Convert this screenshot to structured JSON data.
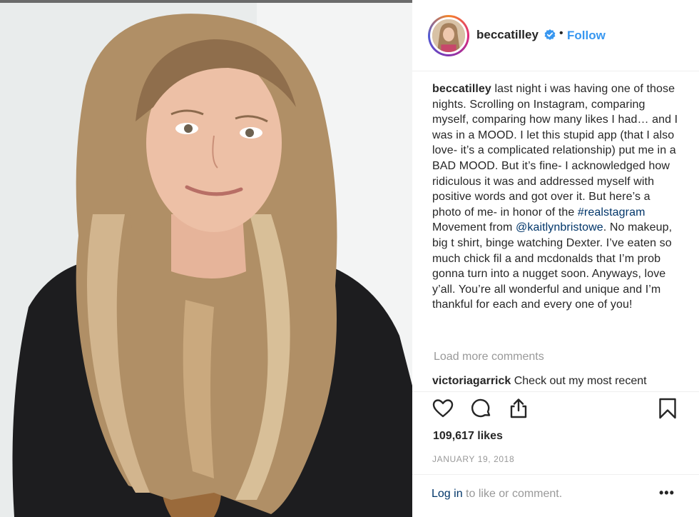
{
  "post": {
    "photo_alt": "selfie photo",
    "username": "beccatilley",
    "follow_label": "Follow",
    "separator": "•"
  },
  "caption": {
    "username": "beccatilley",
    "text_part1": " last night i was having one of those nights. Scrolling on Instagram, comparing myself, comparing how many likes I had… and I was in a MOOD. I let this stupid app (that I also love- it’s a complicated relationship) put me in a BAD MOOD. But it’s fine- I acknowledged how ridiculous it was and addressed myself with positive words and got over it. But here’s a photo of me- in honor of the ",
    "hashtag": "#realstagram",
    "text_part2": " Movement from ",
    "mention": "@kaitlynbristowe",
    "text_part3": ". No makeup, big t shirt, binge watching Dexter. I’ve eaten so much chick fil a and mcdonalds that I’m prob gonna turn into a nugget soon. Anyways, love y’all. You’re all wonderful and unique and I’m thankful for each and every one of you!"
  },
  "comments": {
    "load_more": "Load more comments",
    "items": [
      {
        "username": "victoriagarrick",
        "text": " Check out my most recent"
      }
    ]
  },
  "actions": {
    "like_icon": "heart-icon",
    "comment_icon": "comment-icon",
    "share_icon": "share-icon",
    "save_icon": "bookmark-icon"
  },
  "stats": {
    "likes": "109,617 likes",
    "date": "JANUARY 19, 2018"
  },
  "footer": {
    "login_link": "Log in",
    "login_text": " to like or comment.",
    "more_label": "•••"
  },
  "colors": {
    "link_blue": "#3897f0",
    "hashtag_blue": "#003569",
    "muted_gray": "#999999",
    "text": "#262626"
  }
}
